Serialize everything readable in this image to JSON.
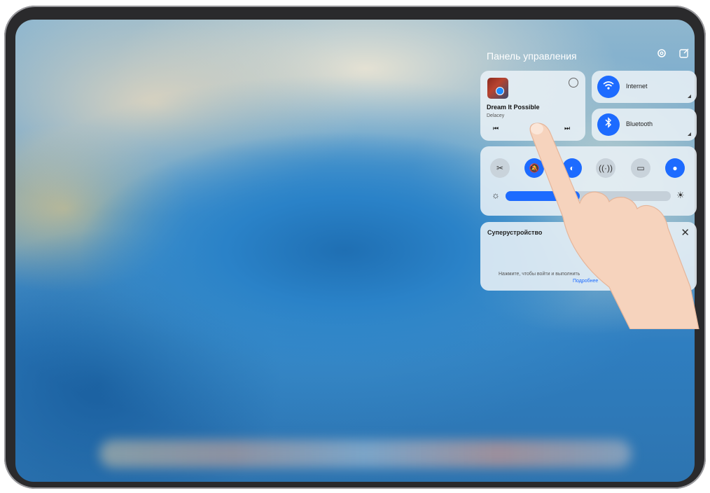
{
  "control_panel": {
    "title": "Панель управления",
    "icons": {
      "settings": "gear-icon",
      "edit": "edit-icon"
    }
  },
  "music": {
    "song": "Dream It Possible",
    "artist": "Delacey",
    "prev_glyph": "⏮",
    "next_glyph": "⏭"
  },
  "connectivity": [
    {
      "label": "Internet",
      "icon": "wifi-icon",
      "glyph": "✦"
    },
    {
      "label": "Bluetooth",
      "icon": "bluetooth-icon",
      "glyph": "✱"
    }
  ],
  "toggles": [
    {
      "icon": "screenshot-icon",
      "state": "off"
    },
    {
      "icon": "silent-icon",
      "state": "on"
    },
    {
      "icon": "eye-comfort-icon",
      "state": "on"
    },
    {
      "icon": "hotspot-icon",
      "state": "off"
    },
    {
      "icon": "multi-screen-icon",
      "state": "off"
    },
    {
      "icon": "location-icon",
      "state": "on"
    }
  ],
  "brightness": {
    "level": 0.45
  },
  "superdevice": {
    "title": "Суперустройство",
    "description": "Нажмите, чтобы войти и выполнить",
    "link": "Подробнее"
  },
  "colors": {
    "accent": "#1d6bff",
    "card": "#e8f0f6"
  }
}
